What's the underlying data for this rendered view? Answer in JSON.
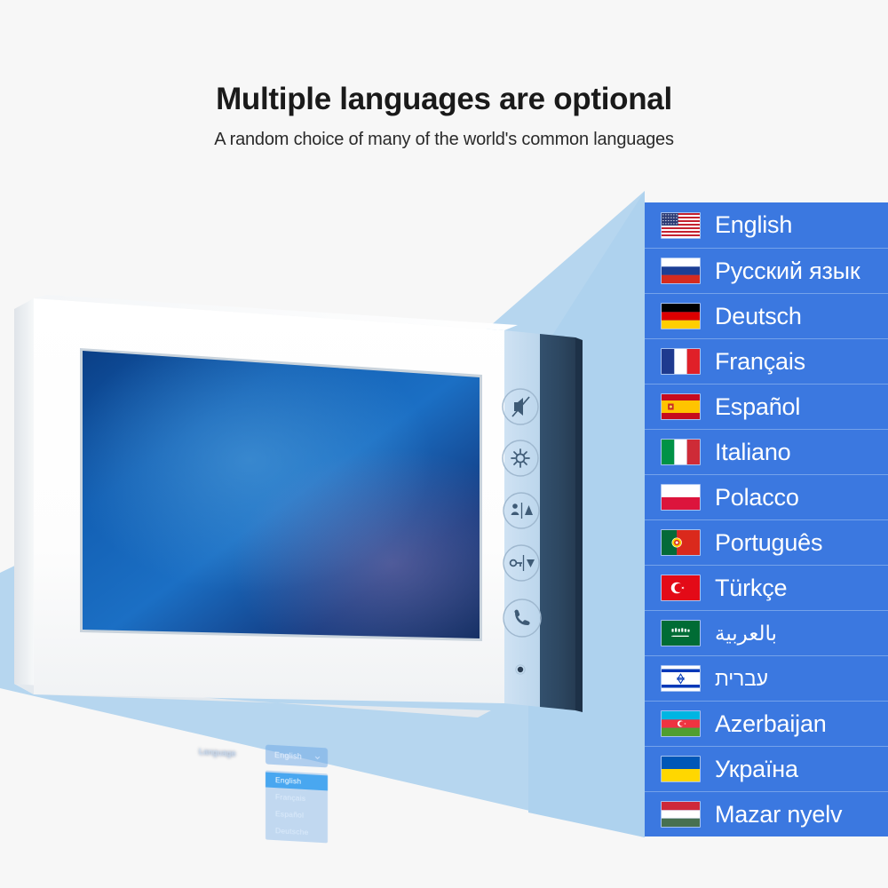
{
  "header": {
    "title": "Multiple languages are optional",
    "subtitle": "A random choice of many of the world's common languages"
  },
  "colors": {
    "background": "#f7f7f7",
    "beam": "#b6d6ef",
    "row_blue": "#3b78e0",
    "row_divider": "#74a2ea",
    "bezel_white": "#ffffff",
    "side_strip_navy": "#2d4761",
    "screen_blue": "#1452a0",
    "highlight_cyan": "#49a7f0",
    "title_text": "#1a1a1a",
    "row_text": "#ffffff"
  },
  "monitor": {
    "screen": {
      "language_label": "Language",
      "selected_value": "English",
      "chevron_icon": "chevron-down-icon",
      "menu_options": [
        {
          "label": "English",
          "selected": true
        },
        {
          "label": "Français",
          "selected": false
        },
        {
          "label": "Español",
          "selected": false
        },
        {
          "label": "Deutsche",
          "selected": false
        }
      ]
    },
    "side_buttons": [
      {
        "name": "mute-button",
        "icon": "speaker-mute-icon"
      },
      {
        "name": "settings-button",
        "icon": "gear-icon"
      },
      {
        "name": "monitor-button",
        "icon": "person-monitor-icon"
      },
      {
        "name": "unlock-button",
        "icon": "key-unlock-icon"
      },
      {
        "name": "call-button",
        "icon": "phone-handset-icon"
      }
    ],
    "microphone": "microphone-hole"
  },
  "language_list": [
    {
      "name": "English",
      "flag": "us",
      "rtl": false
    },
    {
      "name": "Русский язык",
      "flag": "ru",
      "rtl": false
    },
    {
      "name": "Deutsch",
      "flag": "de",
      "rtl": false
    },
    {
      "name": "Français",
      "flag": "fr",
      "rtl": false
    },
    {
      "name": "Español",
      "flag": "es",
      "rtl": false
    },
    {
      "name": "Italiano",
      "flag": "it",
      "rtl": false
    },
    {
      "name": "Polacco",
      "flag": "pl",
      "rtl": false
    },
    {
      "name": "Português",
      "flag": "pt",
      "rtl": false
    },
    {
      "name": "Türkçe",
      "flag": "tr",
      "rtl": false
    },
    {
      "name": "بالعربية",
      "flag": "sa",
      "rtl": true
    },
    {
      "name": "עברית",
      "flag": "il",
      "rtl": true
    },
    {
      "name": "Azerbaijan",
      "flag": "az",
      "rtl": false
    },
    {
      "name": "Україна",
      "flag": "ua",
      "rtl": false
    },
    {
      "name": "Mazar nyelv",
      "flag": "hu",
      "rtl": false
    }
  ]
}
